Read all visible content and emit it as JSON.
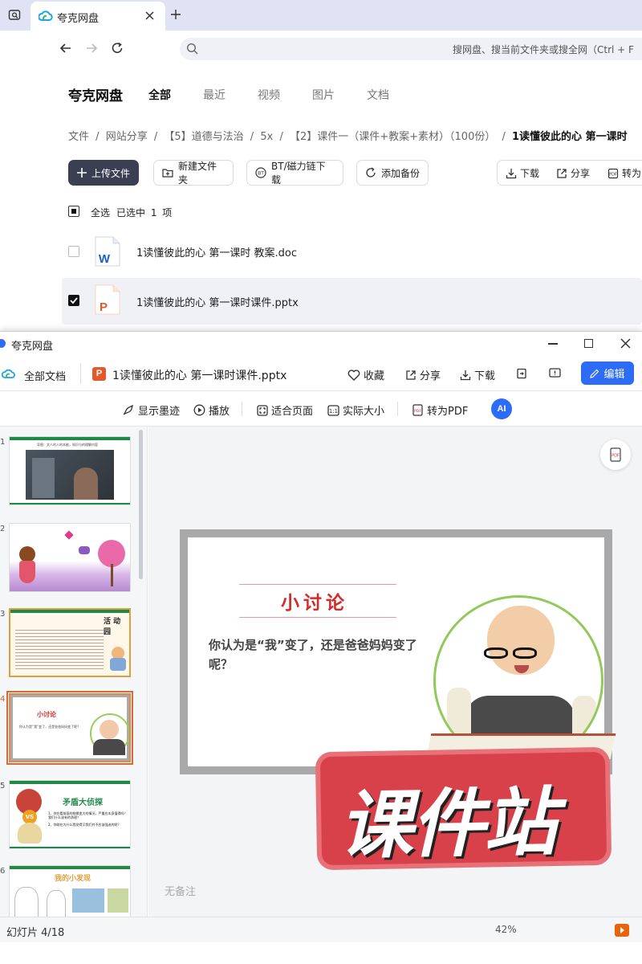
{
  "browser": {
    "tab_title": "夸克网盘",
    "address_placeholder": "搜网盘、搜当前文件夹或搜全网（Ctrl + F"
  },
  "app": {
    "logo": "夸克网盘",
    "nav_tabs": [
      "全部",
      "最近",
      "视频",
      "图片",
      "文档"
    ],
    "breadcrumb": [
      "文件",
      "/",
      "网站分享",
      "/",
      "【5】道德与法治",
      "/",
      "5x",
      "/",
      "【2】课件一（课件+教案+素材）（100份）",
      "/",
      "1读懂彼此的心 第一课时"
    ],
    "actions": {
      "upload": "上传文件",
      "new_folder": "新建文件夹",
      "bt": "BT/磁力链下载",
      "backup": "添加备份",
      "download": "下载",
      "share": "分享",
      "to_pdf": "转为"
    },
    "select_all": "全选",
    "selected_text": "已选中 1 项",
    "files": [
      {
        "name": "1读懂彼此的心  第一课时 教案.doc",
        "icon": "word-icon"
      },
      {
        "name": "1读懂彼此的心  第一课时课件.pptx",
        "icon": "ppt-icon"
      }
    ]
  },
  "viewer": {
    "window_title": "夸克网盘",
    "all_docs": "全部文档",
    "file_name": "1读懂彼此的心 第一课时课件.pptx",
    "fav": "收藏",
    "share": "分享",
    "download": "下载",
    "edit": "编辑",
    "toolbar": {
      "ink": "显示墨迹",
      "play": "播放",
      "fit": "适合页面",
      "actual": "实际大小",
      "to_pdf": "转为PDF"
    },
    "slide_title": "小讨论",
    "slide_question": "你认为是“我”变了，还是爸爸妈妈变了呢？",
    "no_notes": "无备注",
    "status": "幻灯片 4/18",
    "zoom": "42%",
    "watermark": "课件站",
    "thumbs": [
      {
        "n": "1",
        "caption": "导图：文人的人的本能，知识与的理解内容"
      },
      {
        "n": "2",
        "caption": ""
      },
      {
        "n": "3",
        "caption": "活 动 园"
      },
      {
        "n": "4",
        "caption": "小讨论"
      },
      {
        "n": "5",
        "caption": "矛盾大侦探"
      },
      {
        "n": "6",
        "caption": "我的小发现"
      }
    ],
    "thumb4_text": "你认为是“我”变了，还是爸爸妈妈变了呢？",
    "thumb5_lines": [
      "1、你在看前面的物换变大的情况，严重应本身值得吗？我们什么该有的承理？",
      "2、你刚在为什么我觉得又我们并不应该强迫的呢？"
    ]
  },
  "colors": {
    "accent": "#2c6cf6",
    "dark_button": "#3b3f52",
    "slide_red": "#d42a2a",
    "thumb_green": "#1f8a48",
    "watermark_red": "#d8414a"
  }
}
